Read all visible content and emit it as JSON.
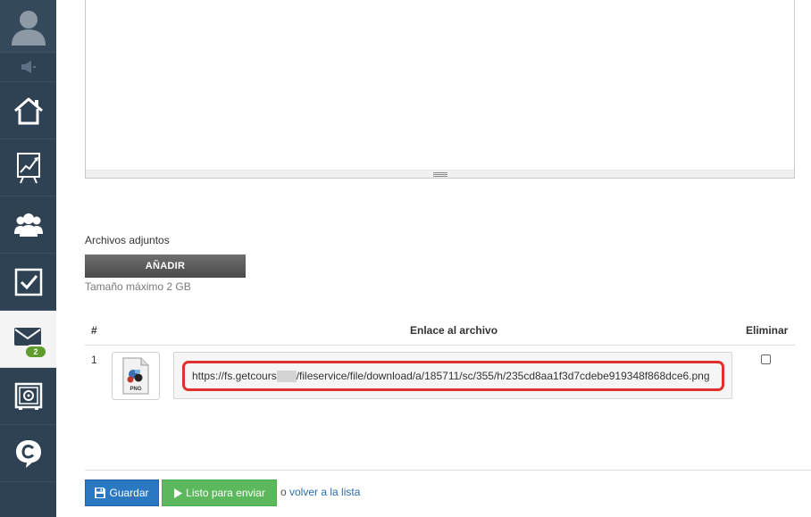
{
  "sidebar": {
    "icons": [
      "user-avatar-icon",
      "speaker-icon",
      "home-icon",
      "chart-icon",
      "users-icon",
      "tasks-icon",
      "mail-icon",
      "safe-icon",
      "chat-icon"
    ],
    "mail_badge": "2"
  },
  "attachments": {
    "label": "Archivos adjuntos",
    "add_button": "AÑADIR",
    "max_size": "Tamaño máximo 2 GB"
  },
  "table": {
    "headers": {
      "number": "#",
      "link": "Enlace al archivo",
      "delete": "Eliminar"
    },
    "rows": [
      {
        "number": "1",
        "file_type": "PNG",
        "link_start": "https://fs.getcours",
        "link_end": "/fileservice/file/download/a/185711/sc/355/h/235cd8aa1f3d7cdebe919348f868dce6.png"
      }
    ]
  },
  "actions": {
    "save": "Guardar",
    "ready": "Listo para enviar",
    "or": "o",
    "back": "volver a la lista"
  },
  "colors": {
    "sidebar": "#2f4254",
    "highlight": "#e0302e",
    "save": "#2a78c2",
    "ready": "#5cb85c"
  }
}
